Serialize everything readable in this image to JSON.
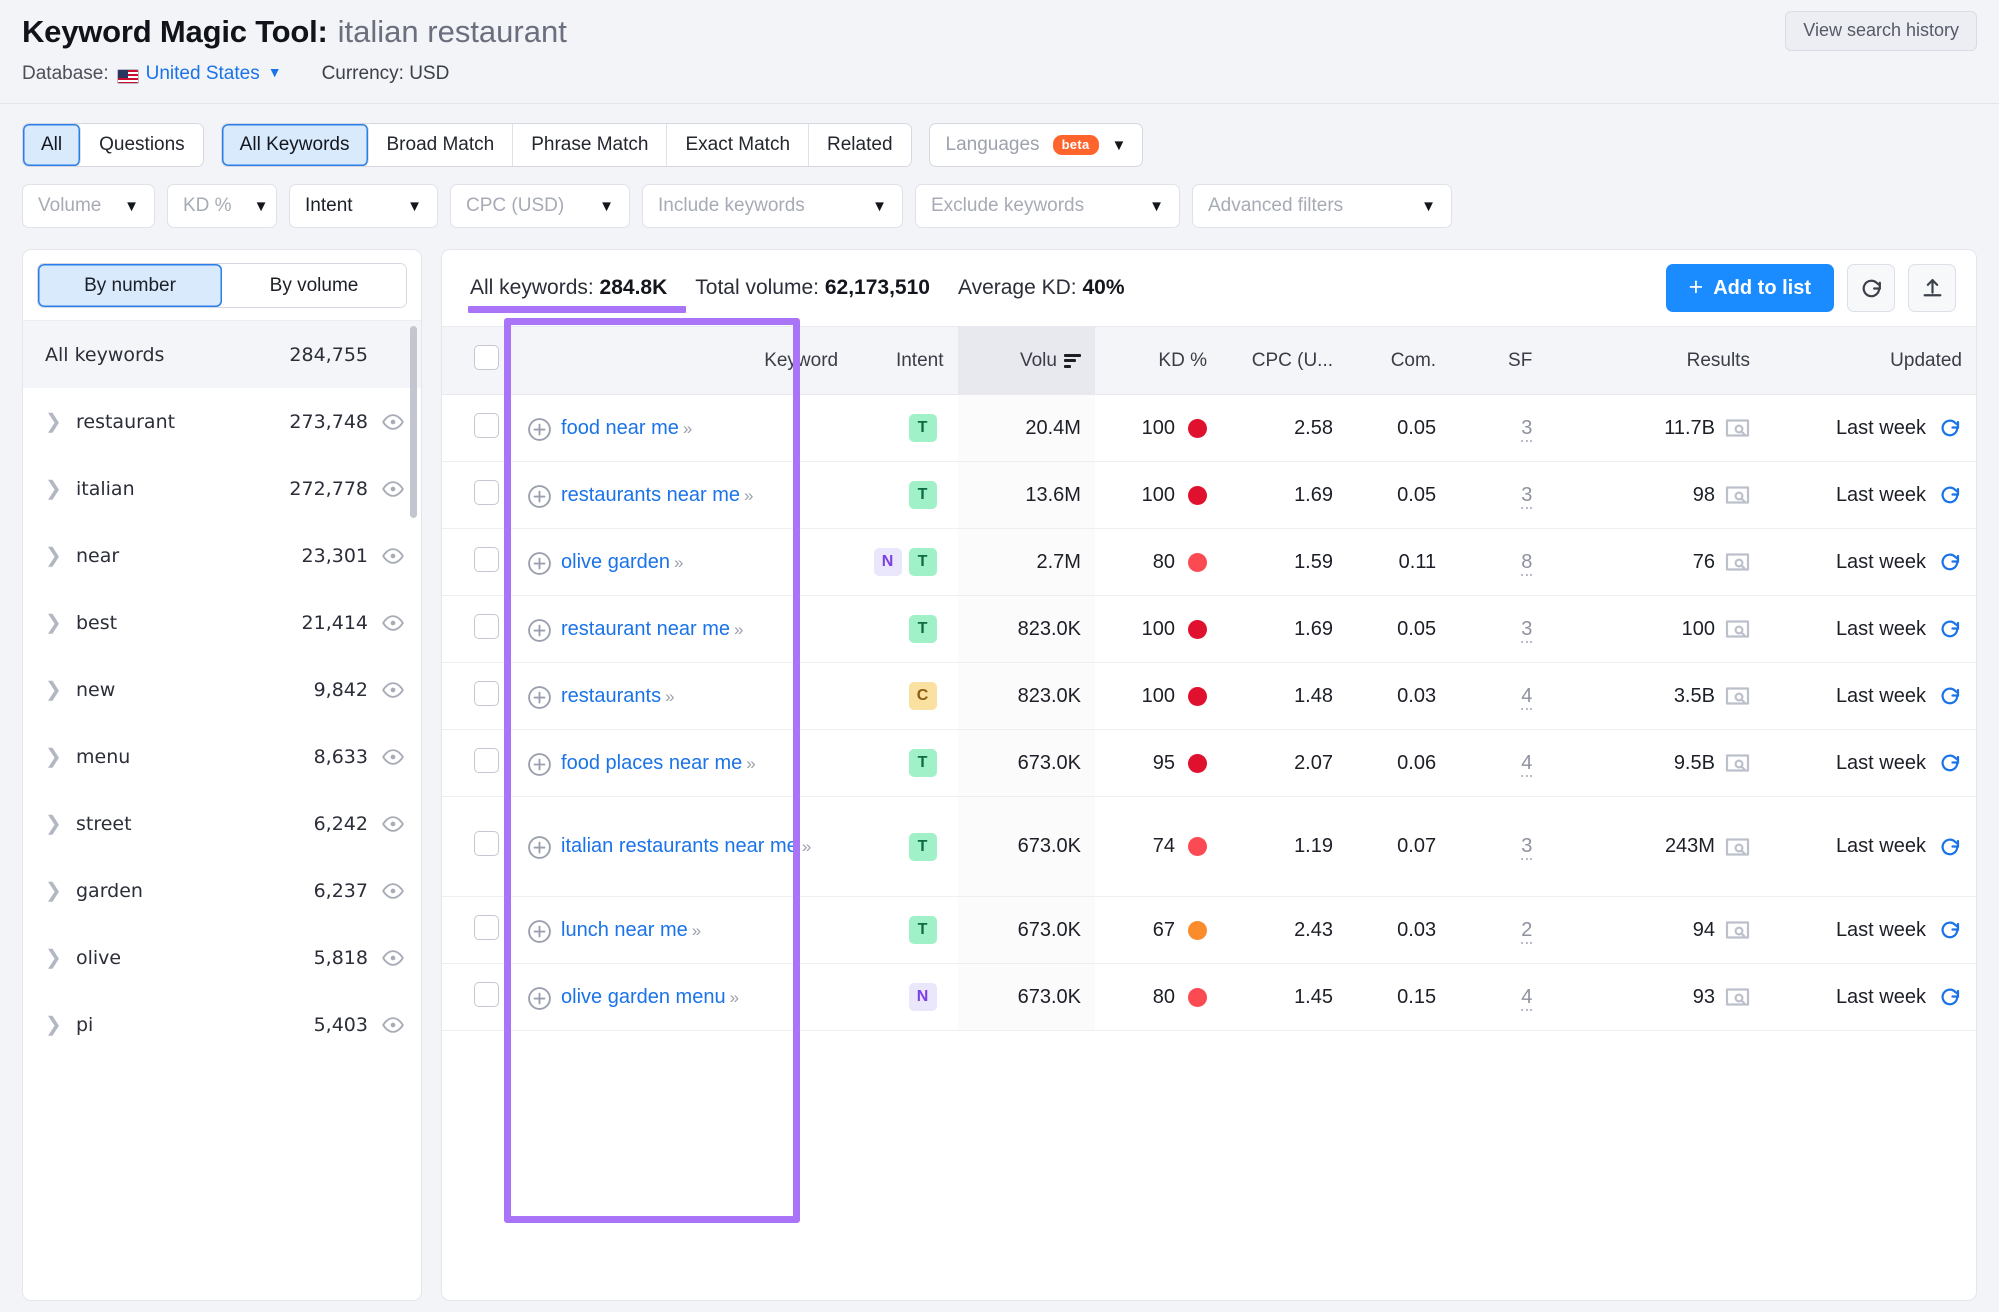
{
  "header": {
    "title": "Keyword Magic Tool:",
    "subject": "italian restaurant",
    "view_history_label": "View search history",
    "database_label": "Database:",
    "database_value": "United States",
    "currency_label": "Currency: USD",
    "flag_icon": "us-flag-icon"
  },
  "toolbar": {
    "type_tabs": [
      {
        "label": "All",
        "active": true
      },
      {
        "label": "Questions",
        "active": false
      }
    ],
    "match_tabs": [
      {
        "label": "All Keywords",
        "active": true
      },
      {
        "label": "Broad Match",
        "active": false
      },
      {
        "label": "Phrase Match",
        "active": false
      },
      {
        "label": "Exact Match",
        "active": false
      },
      {
        "label": "Related",
        "active": false
      }
    ],
    "languages": {
      "label": "Languages",
      "badge": "beta"
    },
    "filters": [
      {
        "label": "Volume",
        "dark": false
      },
      {
        "label": "KD %",
        "dark": false
      },
      {
        "label": "Intent",
        "dark": true
      },
      {
        "label": "CPC (USD)",
        "dark": false
      },
      {
        "label": "Include keywords",
        "dark": false
      },
      {
        "label": "Exclude keywords",
        "dark": false
      },
      {
        "label": "Advanced filters",
        "dark": false
      }
    ]
  },
  "sidebar": {
    "toggle": [
      {
        "label": "By number",
        "active": true
      },
      {
        "label": "By volume",
        "active": false
      }
    ],
    "all_keywords_label": "All keywords",
    "all_keywords_count": "284,755",
    "groups": [
      {
        "name": "restaurant",
        "count": "273,748"
      },
      {
        "name": "italian",
        "count": "272,778"
      },
      {
        "name": "near",
        "count": "23,301"
      },
      {
        "name": "best",
        "count": "21,414"
      },
      {
        "name": "new",
        "count": "9,842"
      },
      {
        "name": "menu",
        "count": "8,633"
      },
      {
        "name": "street",
        "count": "6,242"
      },
      {
        "name": "garden",
        "count": "6,237"
      },
      {
        "name": "olive",
        "count": "5,818"
      },
      {
        "name": "pi",
        "count": "5,403"
      }
    ]
  },
  "summary": {
    "all_keywords_label": "All keywords:",
    "all_keywords_value": "284.8K",
    "total_volume_label": "Total volume:",
    "total_volume_value": "62,173,510",
    "average_kd_label": "Average KD:",
    "average_kd_value": "40%",
    "add_to_list_label": "Add to list",
    "refresh_icon": "refresh-icon",
    "export_icon": "export-icon"
  },
  "table": {
    "columns": {
      "keyword": "Keyword",
      "intent": "Intent",
      "volume": "Volu",
      "kd": "KD %",
      "cpc": "CPC (U...",
      "com": "Com.",
      "sf": "SF",
      "results": "Results",
      "updated": "Updated"
    },
    "rows": [
      {
        "keyword": "food near me",
        "intent": [
          "T"
        ],
        "volume": "20.4M",
        "kd": "100",
        "kd_color": "#e0102f",
        "cpc": "2.58",
        "com": "0.05",
        "sf": "3",
        "results": "11.7B",
        "updated": "Last week"
      },
      {
        "keyword": "restaurants near me",
        "intent": [
          "T"
        ],
        "volume": "13.6M",
        "kd": "100",
        "kd_color": "#e0102f",
        "cpc": "1.69",
        "com": "0.05",
        "sf": "3",
        "results": "98",
        "updated": "Last week"
      },
      {
        "keyword": "olive garden",
        "intent": [
          "N",
          "T"
        ],
        "volume": "2.7M",
        "kd": "80",
        "kd_color": "#fb4a52",
        "cpc": "1.59",
        "com": "0.11",
        "sf": "8",
        "results": "76",
        "updated": "Last week"
      },
      {
        "keyword": "restaurant near me",
        "intent": [
          "T"
        ],
        "volume": "823.0K",
        "kd": "100",
        "kd_color": "#e0102f",
        "cpc": "1.69",
        "com": "0.05",
        "sf": "3",
        "results": "100",
        "updated": "Last week"
      },
      {
        "keyword": "restaurants",
        "intent": [
          "C"
        ],
        "volume": "823.0K",
        "kd": "100",
        "kd_color": "#e0102f",
        "cpc": "1.48",
        "com": "0.03",
        "sf": "4",
        "results": "3.5B",
        "updated": "Last week"
      },
      {
        "keyword": "food places near me",
        "intent": [
          "T"
        ],
        "volume": "673.0K",
        "kd": "95",
        "kd_color": "#e0102f",
        "cpc": "2.07",
        "com": "0.06",
        "sf": "4",
        "results": "9.5B",
        "updated": "Last week"
      },
      {
        "keyword": "italian restaurants near me",
        "intent": [
          "T"
        ],
        "volume": "673.0K",
        "kd": "74",
        "kd_color": "#fb4a52",
        "cpc": "1.19",
        "com": "0.07",
        "sf": "3",
        "results": "243M",
        "updated": "Last week",
        "tall": true
      },
      {
        "keyword": "lunch near me",
        "intent": [
          "T"
        ],
        "volume": "673.0K",
        "kd": "67",
        "kd_color": "#fb8c2b",
        "cpc": "2.43",
        "com": "0.03",
        "sf": "2",
        "results": "94",
        "updated": "Last week"
      },
      {
        "keyword": "olive garden menu",
        "intent": [
          "N"
        ],
        "volume": "673.0K",
        "kd": "80",
        "kd_color": "#fb4a52",
        "cpc": "1.45",
        "com": "0.15",
        "sf": "4",
        "results": "93",
        "updated": "Last week"
      }
    ]
  },
  "annotations": {
    "accent_color": "#a974f7"
  }
}
